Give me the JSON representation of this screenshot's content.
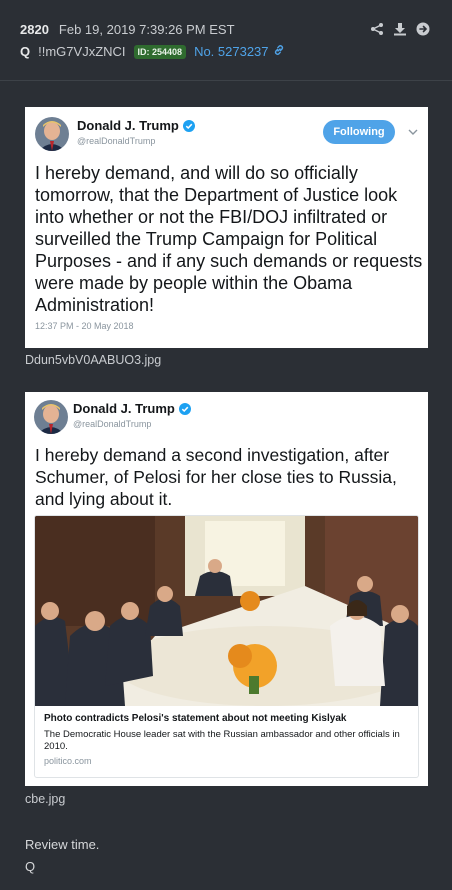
{
  "header": {
    "post_number": "2820",
    "timestamp": "Feb 19, 2019 7:39:26 PM EST",
    "poster_name": "Q",
    "tripcode": "!!mG7VJxZNCI",
    "id_badge": "ID: 254408",
    "post_no_label": "No. 5273237",
    "icons": [
      "share-icon",
      "download-icon",
      "goto-icon",
      "link-icon"
    ]
  },
  "tweet1": {
    "display_name": "Donald J. Trump",
    "handle": "@realDonaldTrump",
    "follow_label": "Following",
    "text": "I hereby demand, and will do so officially tomorrow, that the Department of Justice look into whether or not the FBI/DOJ infiltrated or surveilled the Trump Campaign for Political Purposes - and if any such demands or requests were made by people within the Obama Administration!",
    "timestamp": "12:37 PM - 20 May 2018",
    "filename": "Ddun5vbV0AABUO3.jpg"
  },
  "tweet2": {
    "display_name": "Donald J. Trump",
    "handle": "@realDonaldTrump",
    "text": "I hereby demand a second investigation, after Schumer, of Pelosi for her close ties to Russia, and lying about it.",
    "link_card": {
      "title": "Photo contradicts Pelosi's statement about not meeting Kislyak",
      "description": "The Democratic House leader sat with the Russian ambassador and other officials in 2010.",
      "domain": "politico.com"
    },
    "filename": "cbe.jpg"
  },
  "message": {
    "line1": "Review time.",
    "line2": "Q"
  },
  "colors": {
    "background": "#2b2f35",
    "link_blue": "#4fa3e8",
    "id_badge_green": "#2f6b2f",
    "twitter_blue": "#4fa3e8"
  }
}
